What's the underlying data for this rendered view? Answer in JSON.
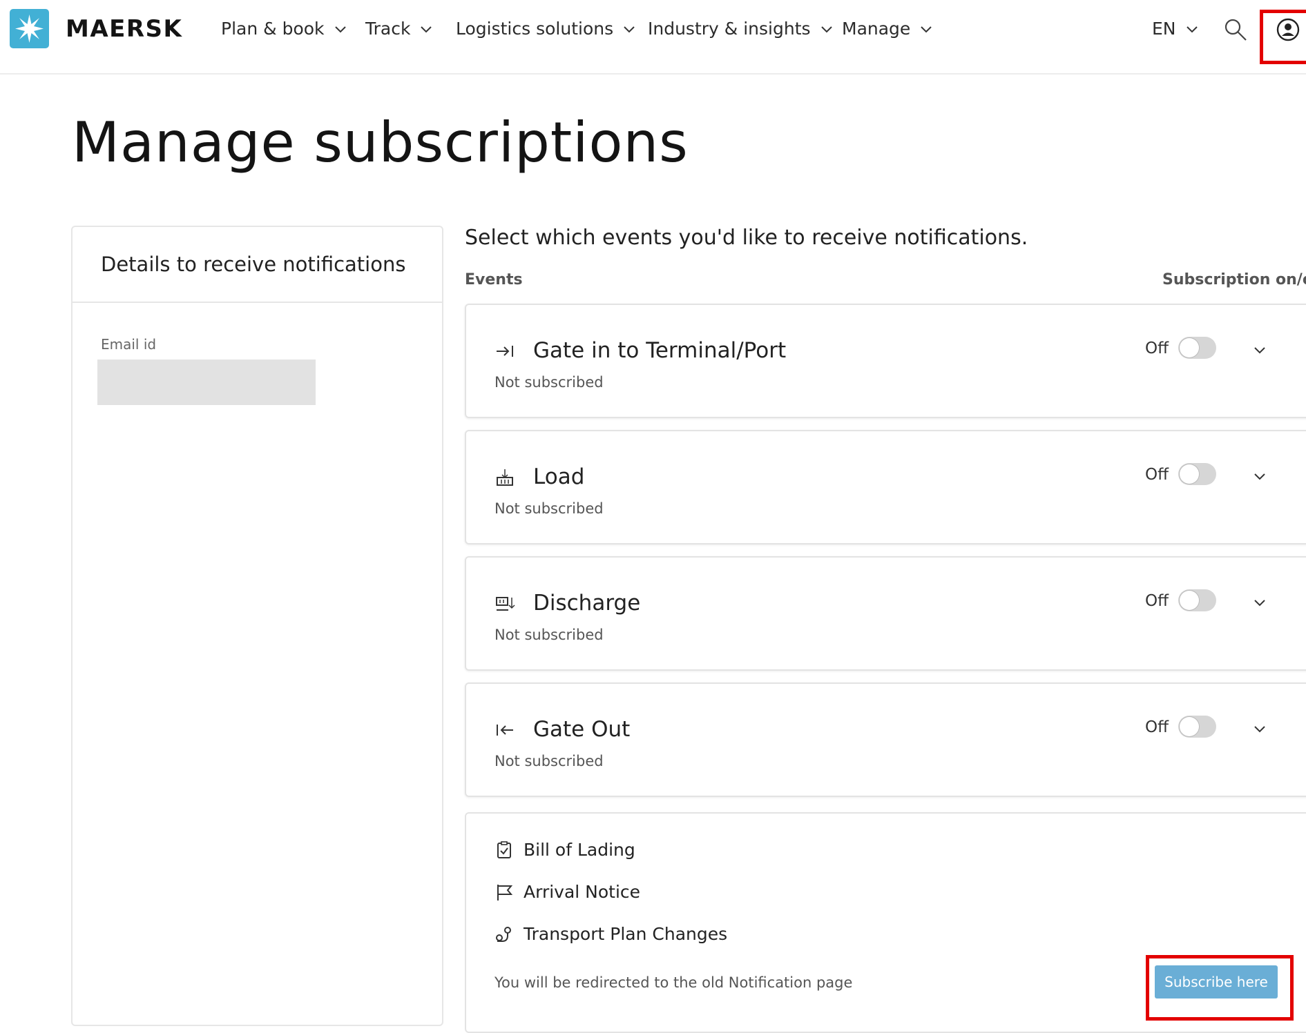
{
  "header": {
    "brand": "MAERSK",
    "nav": [
      {
        "label": "Plan & book"
      },
      {
        "label": "Track"
      },
      {
        "label": "Logistics solutions"
      },
      {
        "label": "Industry & insights"
      },
      {
        "label": "Manage"
      }
    ],
    "language": "EN"
  },
  "page": {
    "title": "Manage subscriptions"
  },
  "details": {
    "heading": "Details to receive notifications",
    "email_label": "Email id"
  },
  "events_panel": {
    "intro": "Select which events you'd like to receive notifications.",
    "col_events": "Events",
    "col_subscription": "Subscription on/off",
    "events": [
      {
        "title": "Gate in to Terminal/Port",
        "status": "Not subscribed",
        "state": "Off",
        "icon": "gate-in-icon"
      },
      {
        "title": "Load",
        "status": "Not subscribed",
        "state": "Off",
        "icon": "load-icon"
      },
      {
        "title": "Discharge",
        "status": "Not subscribed",
        "state": "Off",
        "icon": "discharge-icon"
      },
      {
        "title": "Gate Out",
        "status": "Not subscribed",
        "state": "Off",
        "icon": "gate-out-icon"
      }
    ]
  },
  "legacy": {
    "items": [
      {
        "label": "Bill of Lading",
        "icon": "clipboard-check-icon"
      },
      {
        "label": "Arrival Notice",
        "icon": "flag-icon"
      },
      {
        "label": "Transport Plan Changes",
        "icon": "route-icon"
      }
    ],
    "note": "You will be redirected to the old Notification page",
    "button_label": "Subscribe here"
  },
  "colors": {
    "brand": "#42b0d5",
    "button": "#6aaed6",
    "highlight": "#e30000"
  }
}
